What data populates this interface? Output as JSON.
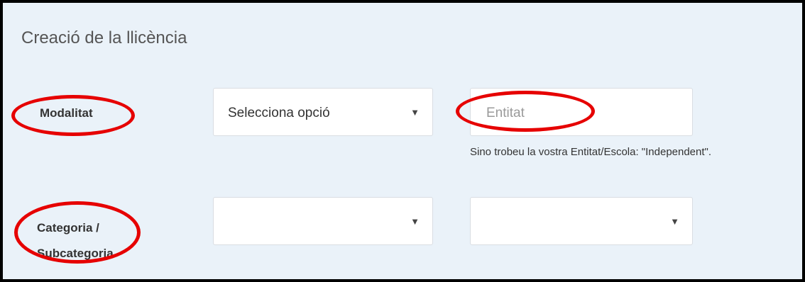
{
  "form": {
    "title": "Creació de la llicència",
    "modalitat_label": "Modalitat",
    "modalitat_select_value": "Selecciona opció",
    "entitat_placeholder": "Entitat",
    "entitat_help": "Sino trobeu la vostra Entitat/Escola: \"Independent\".",
    "categoria_label_line1": "Categoria /",
    "categoria_label_line2": "Subcategoria",
    "categoria_select_value": "",
    "subcategoria_select_value": "",
    "caret": "▼"
  },
  "colors": {
    "panel_bg": "#eaf2f9",
    "annotation_red": "#e60000"
  }
}
